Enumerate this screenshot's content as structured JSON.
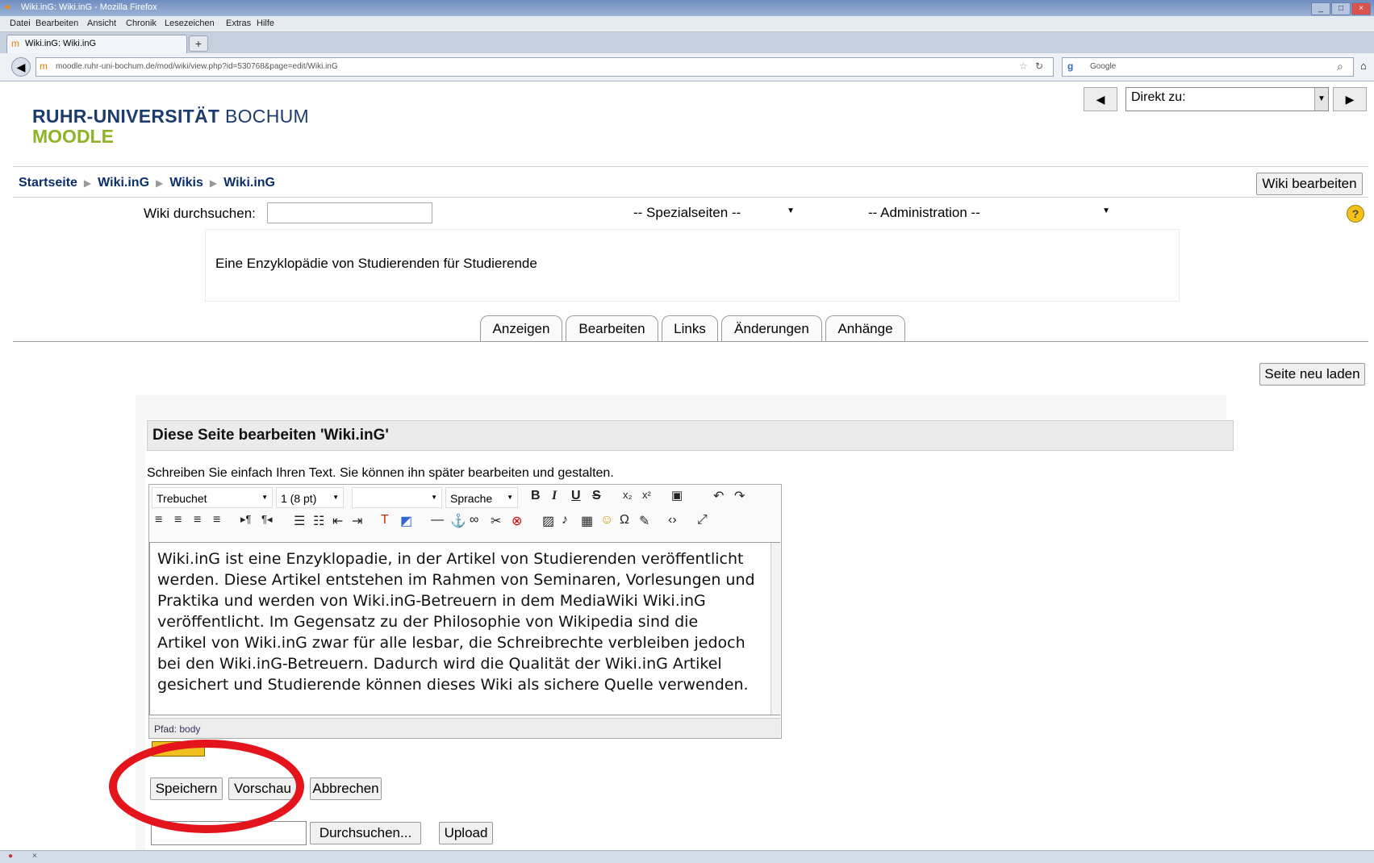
{
  "browser": {
    "title": "Wiki.inG: Wiki.inG - Mozilla Firefox",
    "menu": [
      "Datei",
      "Bearbeiten",
      "Ansicht",
      "Chronik",
      "Lesezeichen",
      "Extras",
      "Hilfe"
    ],
    "tab_title": "Wiki.inG: Wiki.inG",
    "url": "moodle.ruhr-uni-bochum.de/mod/wiki/view.php?id=530768&page=edit/Wiki.inG",
    "search_engine": "Google"
  },
  "header": {
    "logo_line1_bold": "RUHR-UNIVERSITÄT",
    "logo_line1_thin": "BOCHUM",
    "logo_line2": "MOODLE",
    "jump_label": "Direkt zu:"
  },
  "breadcrumb": [
    "Startseite",
    "Wiki.inG",
    "Wikis",
    "Wiki.inG"
  ],
  "wiki_edit_button": "Wiki bearbeiten",
  "search": {
    "label": "Wiki durchsuchen:"
  },
  "special_select": "-- Spezialseiten --",
  "admin_select": "-- Administration --",
  "summary": "Eine Enzyklopädie von Studierenden für Studierende",
  "tabs": [
    "Anzeigen",
    "Bearbeiten",
    "Links",
    "Änderungen",
    "Anhänge"
  ],
  "reload_button": "Seite neu laden",
  "edit": {
    "title": "Diese Seite bearbeiten 'Wiki.inG'",
    "hint": "Schreiben Sie einfach Ihren Text. Sie können ihn später bearbeiten und gestalten.",
    "font": "Trebuchet",
    "size": "1 (8 pt)",
    "language": "Sprache",
    "text_lines": [
      "Wiki.inG ist eine Enzyklopadie, in der Artikel von Studierenden veröffentlicht",
      "werden. Diese Artikel entstehen im Rahmen von Seminaren, Vorlesungen und",
      "Praktika und werden von Wiki.inG-Betreuern in dem MediaWiki Wiki.inG",
      "veröffentlicht. Im Gegensatz zu der Philosophie von Wikipedia sind die",
      "Artikel von Wiki.inG zwar für alle lesbar, die Schreibrechte verbleiben jedoch",
      "bei den Wiki.inG-Betreuern. Dadurch wird die Qualität der Wiki.inG Artikel",
      "gesichert und Studierende können dieses Wiki als sichere Quelle verwenden."
    ],
    "path_label": "Pfad:",
    "path_value": "body"
  },
  "buttons": {
    "save": "Speichern",
    "preview": "Vorschau",
    "cancel": "Abbrechen",
    "browse": "Durchsuchen...",
    "upload": "Upload"
  },
  "colors": {
    "logo_blue": "#1c3c6e",
    "logo_green": "#8fb328",
    "highlight_circle": "#e3141b"
  }
}
